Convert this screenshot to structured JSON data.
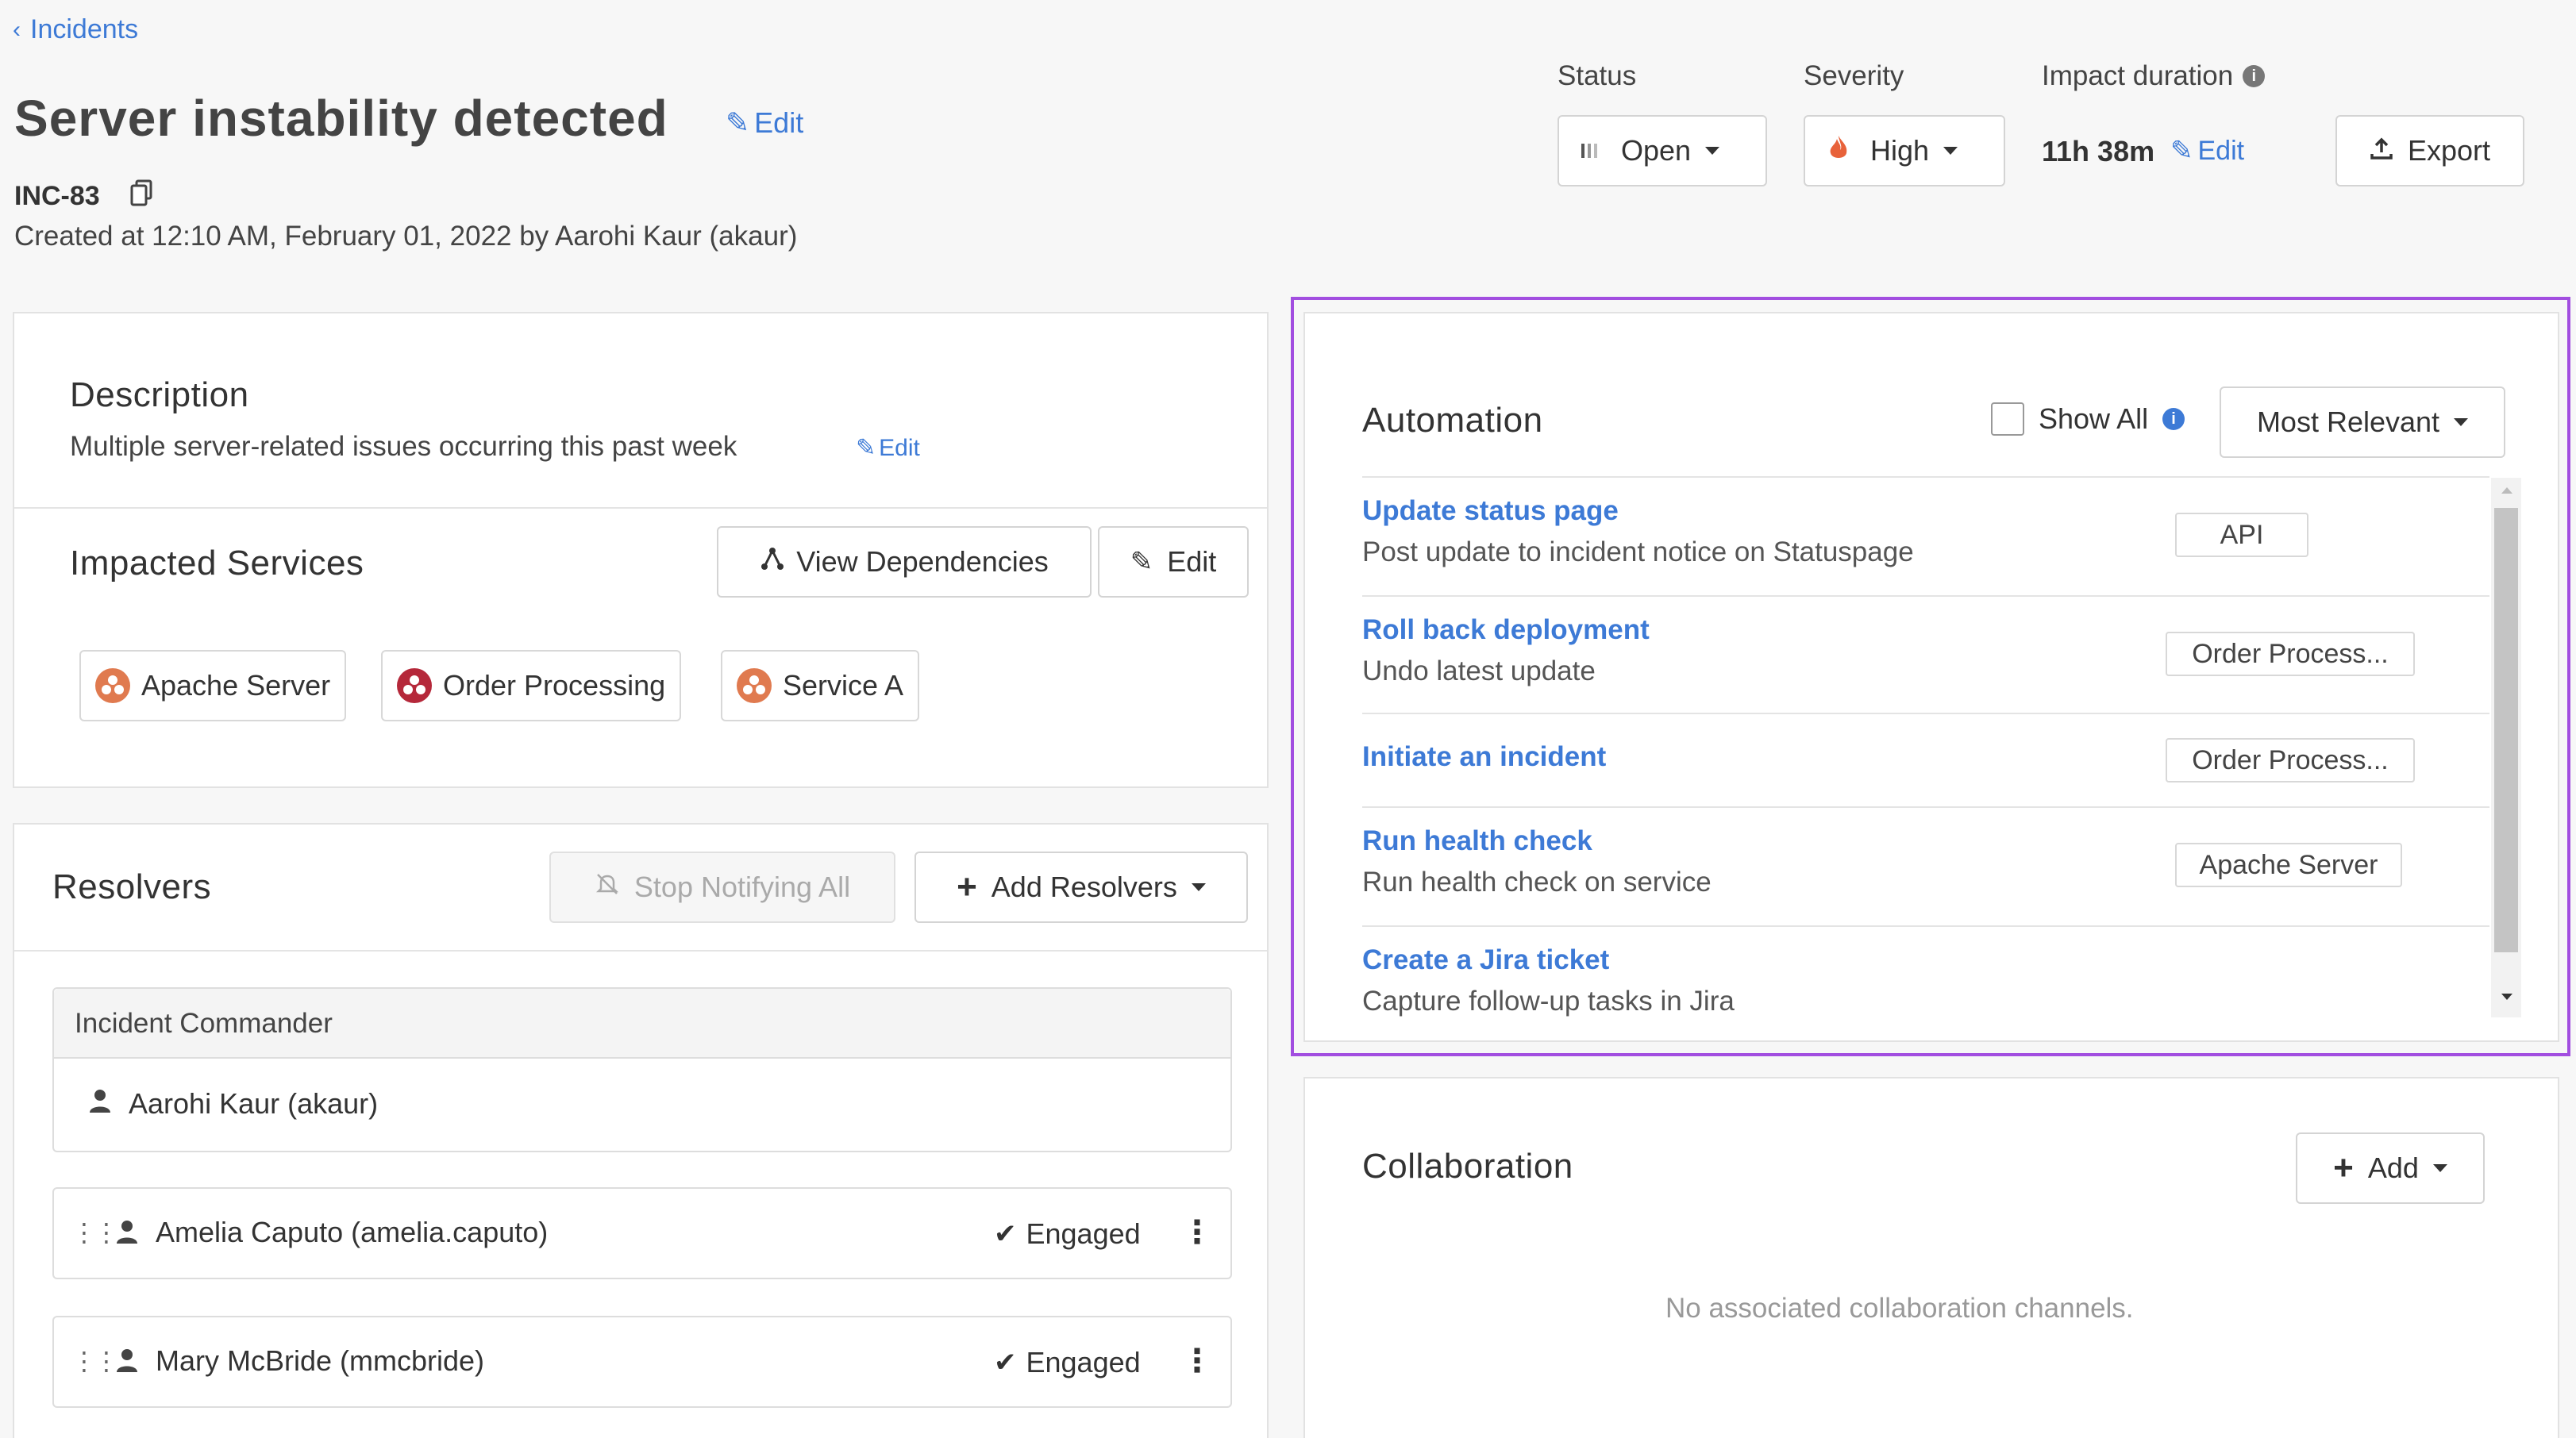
{
  "breadcrumb": {
    "back_label": "Incidents"
  },
  "incident": {
    "title": "Server instability detected",
    "edit_label": "Edit",
    "id": "INC-83",
    "created": "Created at 12:10 AM, February 01, 2022 by Aarohi Kaur (akaur)"
  },
  "header": {
    "status_label": "Status",
    "status_value": "Open",
    "severity_label": "Severity",
    "severity_value": "High",
    "impact_label": "Impact duration",
    "impact_value": "11h 38m",
    "impact_edit": "Edit",
    "export_label": "Export"
  },
  "description": {
    "title": "Description",
    "text": "Multiple server-related issues occurring this past week",
    "edit_label": "Edit"
  },
  "impacted": {
    "title": "Impacted Services",
    "view_deps_label": "View Dependencies",
    "edit_label": "Edit",
    "services": [
      {
        "name": "Apache Server",
        "color": "#e07a4f"
      },
      {
        "name": "Order Processing",
        "color": "#b5283a"
      },
      {
        "name": "Service A",
        "color": "#e07a4f"
      }
    ]
  },
  "resolvers": {
    "title": "Resolvers",
    "stop_label": "Stop Notifying All",
    "add_label": "Add Resolvers",
    "commander_header": "Incident Commander",
    "commander_name": "Aarohi Kaur (akaur)",
    "list": [
      {
        "name": "Amelia Caputo (amelia.caputo)",
        "status": "Engaged"
      },
      {
        "name": "Mary McBride (mmcbride)",
        "status": "Engaged"
      }
    ]
  },
  "automation": {
    "title": "Automation",
    "show_all_label": "Show All",
    "sort_value": "Most Relevant",
    "items": [
      {
        "title": "Update status page",
        "desc": "Post update to incident notice on Statuspage",
        "tag": "API"
      },
      {
        "title": "Roll back deployment",
        "desc": "Undo latest update",
        "tag": "Order Process..."
      },
      {
        "title": "Initiate an incident",
        "desc": "",
        "tag": "Order Process..."
      },
      {
        "title": "Run health check",
        "desc": "Run health check on service",
        "tag": "Apache Server"
      },
      {
        "title": "Create a Jira ticket",
        "desc": "Capture follow-up tasks in Jira",
        "tag": ""
      }
    ]
  },
  "collaboration": {
    "title": "Collaboration",
    "add_label": "Add",
    "empty_text": "No associated collaboration channels."
  },
  "colors": {
    "accent": "#3d7ad6",
    "highlight_border": "#a24ee0",
    "severity_flame": "#e8623a"
  }
}
